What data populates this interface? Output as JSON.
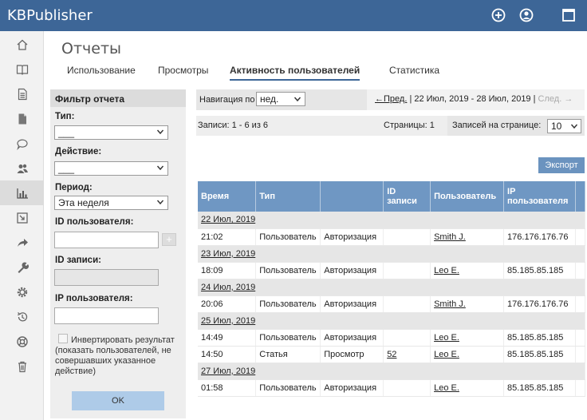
{
  "app": {
    "title": "KBPublisher"
  },
  "page": {
    "title": "Отчеты",
    "tabs": [
      {
        "label": "Использование"
      },
      {
        "label": "Просмотры"
      },
      {
        "label": "Активность пользователей"
      },
      {
        "label": "Статистика"
      }
    ],
    "active_tab": "Активность пользователей"
  },
  "sidebar": {
    "items": [
      {
        "icon": "home-icon"
      },
      {
        "icon": "book-icon"
      },
      {
        "icon": "document-icon"
      },
      {
        "icon": "file-icon"
      },
      {
        "icon": "chat-icon"
      },
      {
        "icon": "users-icon"
      },
      {
        "icon": "bar-chart-icon"
      },
      {
        "icon": "import-icon"
      },
      {
        "icon": "share-icon"
      },
      {
        "icon": "wrench-icon"
      },
      {
        "icon": "gear-icon"
      },
      {
        "icon": "history-icon"
      },
      {
        "icon": "help-icon"
      },
      {
        "icon": "trash-icon"
      }
    ],
    "active_index": 6
  },
  "filter": {
    "title": "Фильтр отчета",
    "type_label": "Тип:",
    "type_value": "___",
    "action_label": "Действие:",
    "action_value": "___",
    "period_label": "Период:",
    "period_value": "Эта неделя",
    "user_id_label": "ID пользователя:",
    "user_id_value": "",
    "plus_label": "+",
    "record_id_label": "ID записи:",
    "ip_label": "IP пользователя:",
    "ip_value": "",
    "invert_label": "Инвертировать результат (показать пользователей, не совершавших указанное действие)",
    "ok_label": "OK"
  },
  "navigation": {
    "label": "Навигация по",
    "value": "нед.",
    "prev_label": "←Пред.",
    "separator": "|",
    "date_range": "22 Июл, 2019 - 28 Июл, 2019",
    "next_label": "След. →"
  },
  "summary": {
    "records": "Записи: 1 - 6 из 6",
    "pages": "Страницы: 1",
    "per_page_label": "Записей на странице:",
    "per_page_value": "10"
  },
  "export_label": "Экспорт",
  "table": {
    "headers": [
      "Время",
      "Тип",
      "",
      "ID записи",
      "Пользователь",
      "IP пользователя"
    ],
    "dates": [
      "22 Июл, 2019",
      "23 Июл, 2019",
      "24 Июл, 2019",
      "25 Июл, 2019",
      "27 Июл, 2019"
    ],
    "rows": [
      {
        "time": "21:02",
        "type": "Пользователь",
        "action": "Авторизация",
        "entry_id": "",
        "user": "Smith J.",
        "ip": "176.176.176.76"
      },
      {
        "time": "18:09",
        "type": "Пользователь",
        "action": "Авторизация",
        "entry_id": "",
        "user": "Leo E.",
        "ip": "85.185.85.185"
      },
      {
        "time": "20:06",
        "type": "Пользователь",
        "action": "Авторизация",
        "entry_id": "",
        "user": "Smith J.",
        "ip": "176.176.176.76"
      },
      {
        "time": "14:49",
        "type": "Пользователь",
        "action": "Авторизация",
        "entry_id": "",
        "user": "Leo E.",
        "ip": "85.185.85.185"
      },
      {
        "time": "14:50",
        "type": "Статья",
        "action": "Просмотр",
        "entry_id": "52",
        "user": "Leo E.",
        "ip": "85.185.85.185"
      },
      {
        "time": "01:58",
        "type": "Пользователь",
        "action": "Авторизация",
        "entry_id": "",
        "user": "Leo E.",
        "ip": "85.185.85.185"
      }
    ]
  },
  "colors": {
    "topbar": "#3d6697",
    "table_header": "#6f97c3",
    "export_button": "#6b93bf",
    "ok_button": "#aecbe8"
  }
}
